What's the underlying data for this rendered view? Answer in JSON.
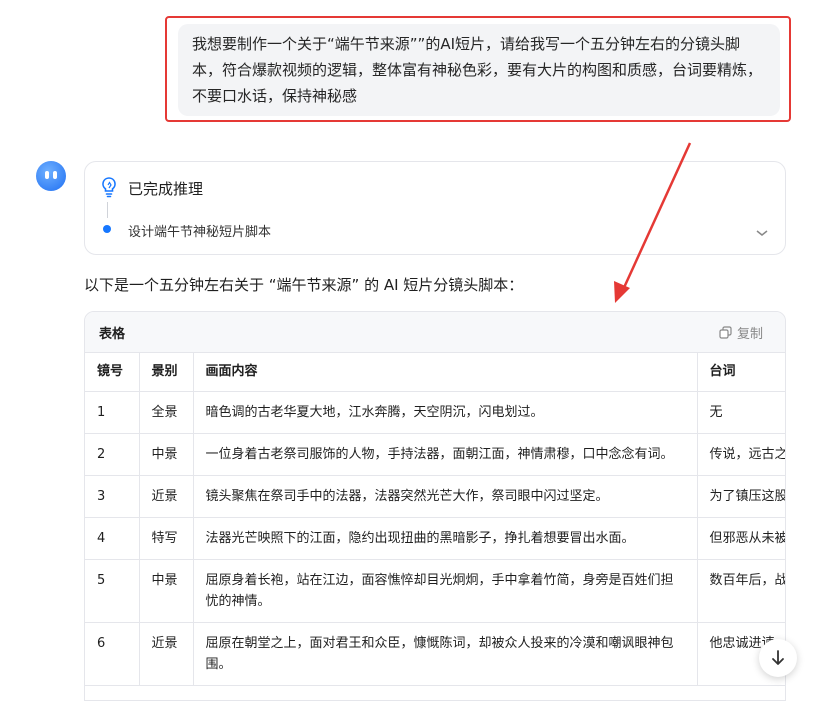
{
  "user_message": "我想要制作一个关于“端午节来源””的AI短片，请给我写一个五分钟左右的分镜头脚本，符合爆款视频的逻辑，整体富有神秘色彩，要有大片的构图和质感，台词要精炼，不要口水话，保持神秘感",
  "reasoning": {
    "title": "已完成推理",
    "step": "设计端午节神秘短片脚本"
  },
  "intro_text": "以下是一个五分钟左右关于 “端午节来源” 的 AI 短片分镜头脚本：",
  "table": {
    "label": "表格",
    "copy_label": "复制",
    "headers": [
      "镜号",
      "景别",
      "画面内容",
      "台词"
    ],
    "rows": [
      [
        "1",
        "全景",
        "暗色调的古老华夏大地，江水奔腾，天空阴沉，闪电划过。",
        "无"
      ],
      [
        "2",
        "中景",
        "一位身着古老祭司服饰的人物，手持法器，面朝江面，神情肃穆，口中念念有词。",
        "传说，远古之"
      ],
      [
        "3",
        "近景",
        "镜头聚焦在祭司手中的法器，法器突然光芒大作，祭司眼中闪过坚定。",
        "为了镇压这股"
      ],
      [
        "4",
        "特写",
        "法器光芒映照下的江面，隐约出现扭曲的黑暗影子，挣扎着想要冒出水面。",
        "但邪恶从未被"
      ],
      [
        "5",
        "中景",
        "屈原身着长袍，站在江边，面容憔悴却目光炯炯，手中拿着竹简，身旁是百姓们担忧的神情。",
        "数百年后，战"
      ],
      [
        "6",
        "近景",
        "屈原在朝堂之上，面对君王和众臣，慷慨陈词，却被众人投来的冷漠和嘲讽眼神包围。",
        "他忠诚进谏，"
      ]
    ]
  },
  "colors": {
    "highlight": "#e53935",
    "accent": "#1677ff"
  }
}
